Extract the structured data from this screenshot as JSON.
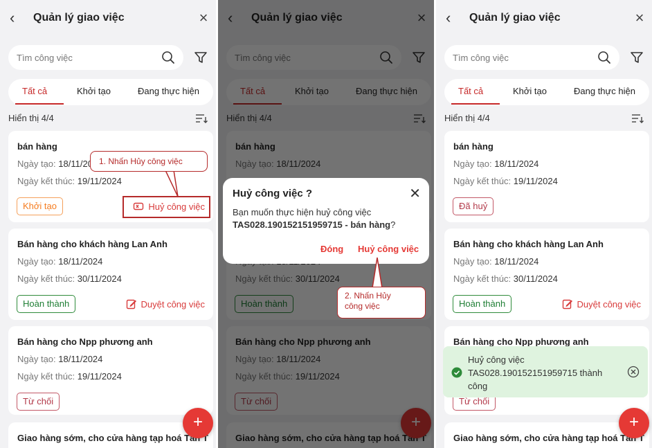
{
  "app": {
    "title": "Quản lý giao việc",
    "back_icon": "back-arrow-icon",
    "close_icon": "close-icon",
    "search_placeholder": "Tìm công việc",
    "tabs": [
      "Tất cả",
      "Khởi tạo",
      "Đang thực hiện"
    ],
    "count_label": "Hiển thị 4/4",
    "date_created_label": "Ngày tạo:",
    "date_end_label": "Ngày kết thúc:",
    "accent_color": "#c62828"
  },
  "screen1": {
    "cards": [
      {
        "title": "bán hàng",
        "created": "18/11/2024",
        "end": "19/11/2024",
        "status": "Khởi tạo",
        "action": "Huỷ công việc"
      },
      {
        "title": "Bán hàng cho khách hàng Lan Anh",
        "created": "18/11/2024",
        "end": "30/11/2024",
        "status": "Hoàn thành",
        "action": "Duyệt công việc"
      },
      {
        "title": "Bán hàng cho Npp phương anh",
        "created": "18/11/2024",
        "end": "19/11/2024",
        "status": "Từ chối"
      },
      {
        "title": "Giao hàng sớm, cho cửa hàng tạp hoá Tân T"
      }
    ],
    "callout": "1. Nhấn Hủy công việc"
  },
  "screen2": {
    "dialog": {
      "title": "Huỷ công việc ?",
      "message_prefix": "Bạn muốn thực hiện huỷ công việc",
      "message_code": "TAS028.190152151959715 - bán hàng",
      "message_suffix": "?",
      "close_button": "Đóng",
      "confirm_button": "Huỷ công việc"
    },
    "callout_line1": "2. Nhấn Hủy",
    "callout_line2": "công việc"
  },
  "screen3": {
    "cards": [
      {
        "title": "bán hàng",
        "created": "18/11/2024",
        "end": "19/11/2024",
        "status": "Đã huỷ"
      },
      {
        "title": "Bán hàng cho khách hàng Lan Anh",
        "created": "18/11/2024",
        "end": "30/11/2024",
        "status": "Hoàn thành",
        "action": "Duyệt công việc"
      },
      {
        "title": "Bán hàng cho Npp phương anh",
        "status": "Từ chối"
      },
      {
        "title": "Giao hàng sớm, cho cửa hàng tạp hoá Tân T"
      }
    ],
    "toast": "Huỷ công việc TAS028.190152151959715 thành công"
  }
}
